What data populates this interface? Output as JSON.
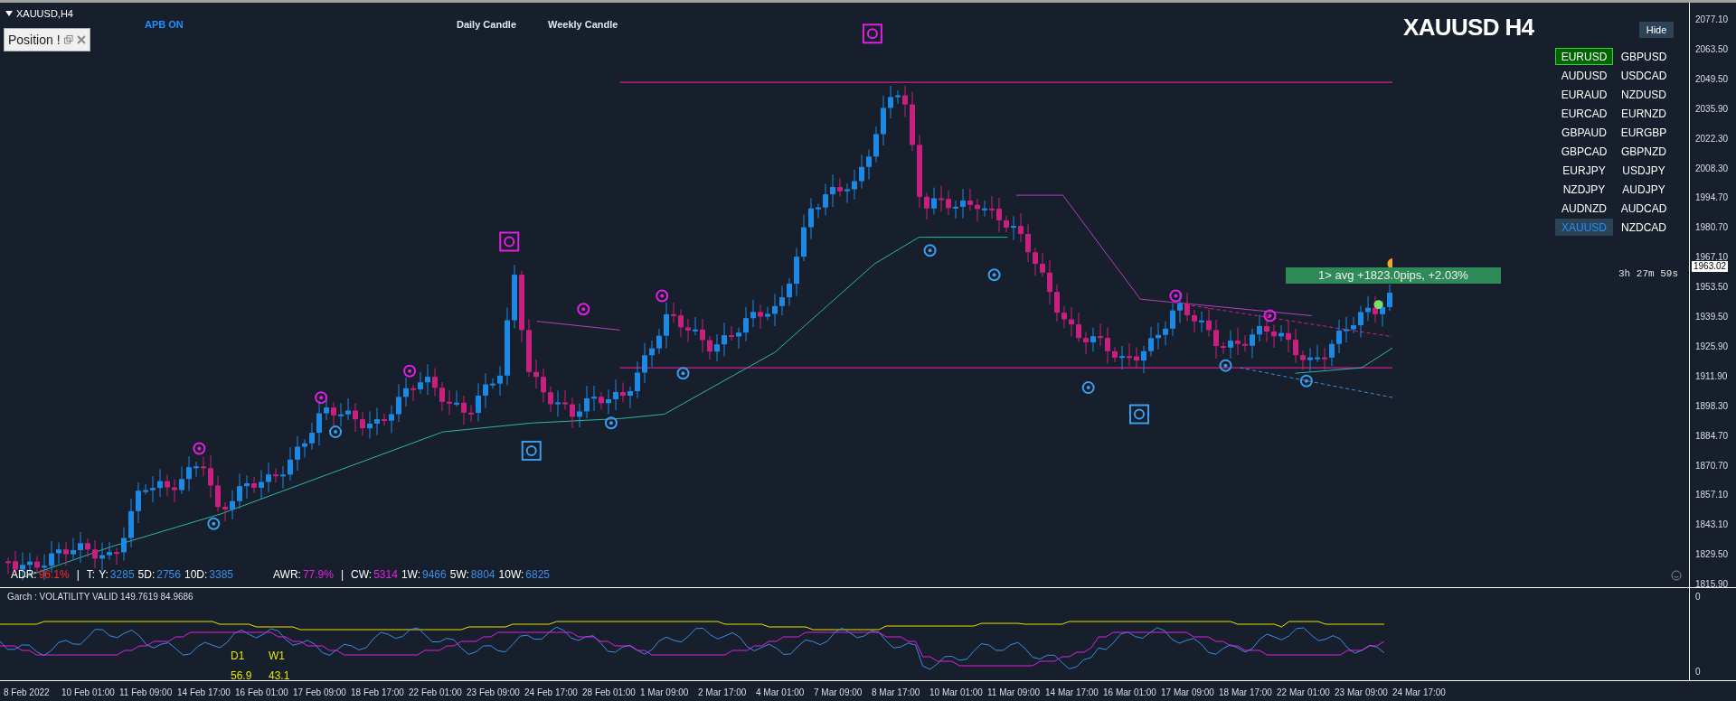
{
  "window": {
    "title": "XAUUSD,H4"
  },
  "position_panel": {
    "title": "Position !"
  },
  "chart_labels": {
    "status": "APB ON",
    "daily": "Daily Candle",
    "weekly": "Weekly Candle",
    "symbol_title": "XAUUSD H4"
  },
  "hide_button": "Hide",
  "symbols": [
    {
      "label": "EURUSD",
      "selected": false,
      "marked": true
    },
    {
      "label": "GBPUSD",
      "selected": false,
      "marked": false
    },
    {
      "label": "AUDUSD",
      "selected": false,
      "marked": false
    },
    {
      "label": "USDCAD",
      "selected": false,
      "marked": false
    },
    {
      "label": "EURAUD",
      "selected": false,
      "marked": false
    },
    {
      "label": "NZDUSD",
      "selected": false,
      "marked": false
    },
    {
      "label": "EURCAD",
      "selected": false,
      "marked": false
    },
    {
      "label": "EURNZD",
      "selected": false,
      "marked": false
    },
    {
      "label": "GBPAUD",
      "selected": false,
      "marked": false
    },
    {
      "label": "EURGBP",
      "selected": false,
      "marked": false
    },
    {
      "label": "GBPCAD",
      "selected": false,
      "marked": false
    },
    {
      "label": "GBPNZD",
      "selected": false,
      "marked": false
    },
    {
      "label": "EURJPY",
      "selected": false,
      "marked": false
    },
    {
      "label": "USDJPY",
      "selected": false,
      "marked": false
    },
    {
      "label": "NZDJPY",
      "selected": false,
      "marked": false
    },
    {
      "label": "AUDJPY",
      "selected": false,
      "marked": false
    },
    {
      "label": "AUDNZD",
      "selected": false,
      "marked": false
    },
    {
      "label": "AUDCAD",
      "selected": false,
      "marked": false
    },
    {
      "label": "XAUUSD",
      "selected": true,
      "marked": false
    },
    {
      "label": "NZDCAD",
      "selected": false,
      "marked": false
    }
  ],
  "trade_banner": "1> avg +1823.0pips, +2.03%",
  "countdown": "3h 27m 59s",
  "info_bar": [
    {
      "kind": "pair",
      "label": "ADR:",
      "value": "96.1%",
      "color": "#ff2a2a"
    },
    {
      "kind": "separator",
      "label": "|"
    },
    {
      "kind": "pair",
      "label": "T:"
    },
    {
      "kind": "pair",
      "label": "Y:",
      "value": "3285",
      "color": "#3a8ee6"
    },
    {
      "kind": "pair",
      "label": "5D:",
      "value": "2756",
      "color": "#3a8ee6"
    },
    {
      "kind": "pair",
      "label": "10D:",
      "value": "3385",
      "color": "#3a8ee6"
    },
    {
      "kind": "gap"
    },
    {
      "kind": "pair",
      "label": "AWR:",
      "value": "77.9%",
      "color": "#e020e0"
    },
    {
      "kind": "separator",
      "label": "|"
    },
    {
      "kind": "pair",
      "label": "CW:",
      "value": "5314",
      "color": "#e020e0"
    },
    {
      "kind": "pair",
      "label": "1W:",
      "value": "9466",
      "color": "#3a8ee6"
    },
    {
      "kind": "pair",
      "label": "5W:",
      "value": "8804",
      "color": "#3a8ee6"
    },
    {
      "kind": "pair",
      "label": "10W:",
      "value": "6825",
      "color": "#3a8ee6"
    }
  ],
  "price_axis": [
    "2077.10",
    "2063.50",
    "2049.50",
    "2035.90",
    "2022.30",
    "2008.30",
    "1994.70",
    "1980.70",
    "1967.10",
    "1953.50",
    "1939.50",
    "1925.90",
    "1911.90",
    "1898.30",
    "1884.70",
    "1870.70",
    "1857.10",
    "1843.10",
    "1829.50",
    "1815.90"
  ],
  "current_price": "1963.02",
  "indicator": {
    "title": "Garch : VOLATILITY VALID 149.7619 84.9686",
    "labels": [
      {
        "name": "D1",
        "value": "56.9"
      },
      {
        "name": "W1",
        "value": "43.1"
      }
    ],
    "axis": [
      "0",
      "0"
    ]
  },
  "time_axis": [
    "8 Feb 2022",
    "10 Feb 01:00",
    "11 Feb 09:00",
    "14 Feb 17:00",
    "16 Feb 01:00",
    "17 Feb 09:00",
    "18 Feb 17:00",
    "22 Feb 01:00",
    "23 Feb 09:00",
    "24 Feb 17:00",
    "28 Feb 01:00",
    "1 Mar 09:00",
    "2 Mar 17:00",
    "4 Mar 01:00",
    "7 Mar 09:00",
    "8 Mar 17:00",
    "10 Mar 01:00",
    "11 Mar 09:00",
    "14 Mar 17:00",
    "16 Mar 01:00",
    "17 Mar 09:00",
    "18 Mar 17:00",
    "22 Mar 01:00",
    "23 Mar 09:00",
    "24 Mar 17:00"
  ]
}
